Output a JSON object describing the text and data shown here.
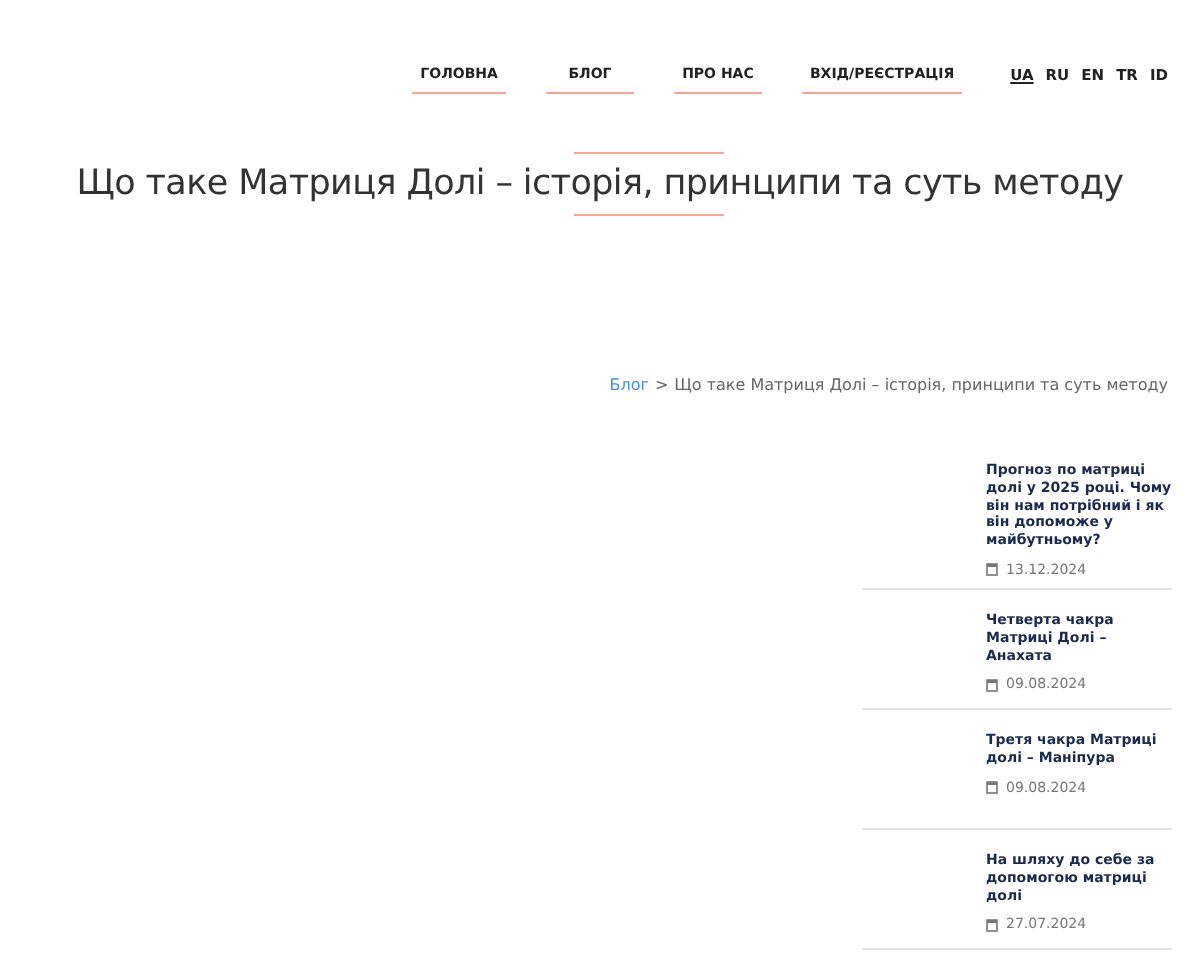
{
  "nav": {
    "items": [
      {
        "label": "ГОЛОВНА"
      },
      {
        "label": "БЛОГ"
      },
      {
        "label": "ПРО НАС"
      },
      {
        "label": "ВХІД/РЕЄСТРАЦІЯ"
      }
    ],
    "languages": [
      {
        "label": "UA",
        "selected": true
      },
      {
        "label": "RU",
        "selected": false
      },
      {
        "label": "EN",
        "selected": false
      },
      {
        "label": "TR",
        "selected": false
      },
      {
        "label": "ID",
        "selected": false
      }
    ]
  },
  "title": "Що таке Матриця Долі – історія, принципи та суть методу",
  "breadcrumb": {
    "link": "Блог",
    "separator": ">",
    "current": "Що таке Матриця Долі – історія, принципи та суть методу"
  },
  "posts": [
    {
      "title": "Прогноз по матриці долі у 2025 році. Чому він нам потрібний і як він допоможе у майбутньому?",
      "date": "13.12.2024"
    },
    {
      "title": "Четверта чакра Матриці Долі – Анахата",
      "date": "09.08.2024"
    },
    {
      "title": "Третя чакра Матриці долі – Маніпура",
      "date": "09.08.2024"
    },
    {
      "title": "На шляху до себе за допомогою матриці долі",
      "date": "27.07.2024"
    }
  ]
}
